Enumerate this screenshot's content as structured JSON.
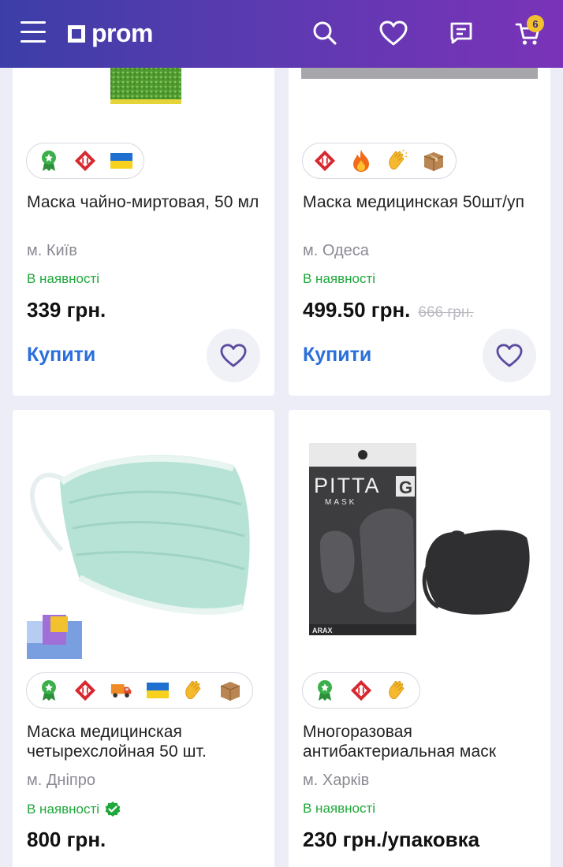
{
  "header": {
    "logo_text": "prom",
    "cart_count": "6",
    "icons": [
      "menu-icon",
      "search-icon",
      "heart-icon",
      "messages-icon",
      "cart-icon"
    ],
    "colors": {
      "gradient_start": "#3c3ea7",
      "gradient_end": "#7a33b8",
      "badge": "#f2c12e"
    }
  },
  "products": [
    {
      "title": "Маска чайно-миртовая, 50 мл",
      "city": "м. Київ",
      "stock": "В наявності",
      "price": "339 грн.",
      "old_price": "",
      "buy_label": "Купити",
      "badges": [
        "award-icon",
        "nova-poshta-icon",
        "ukraine-flag-icon"
      ]
    },
    {
      "title": "Маска медицинская 50шт/уп",
      "city": "м. Одеса",
      "stock": "В наявності",
      "price": "499.50 грн.",
      "old_price": "666 грн.",
      "buy_label": "Купити",
      "badges": [
        "nova-poshta-icon",
        "fire-icon",
        "clapping-hands-icon",
        "package-icon"
      ]
    },
    {
      "title": "Маска медицинская четырехслойная 50 шт.",
      "city": "м. Дніпро",
      "stock": "В наявності",
      "price": "800 грн.",
      "verified": true,
      "badges": [
        "award-icon",
        "nova-poshta-icon",
        "delivery-truck-icon",
        "ukraine-flag-icon",
        "clapping-hands-icon",
        "package-icon"
      ]
    },
    {
      "title": "Многоразовая антибактериальная маск",
      "city": "м. Харків",
      "stock": "В наявності",
      "price": "230 грн./упаковка",
      "badges": [
        "award-icon",
        "nova-poshta-icon",
        "clapping-hands-icon"
      ],
      "image_text": {
        "brand": "PITTA",
        "letter": "G",
        "sub": "MASK",
        "maker": "ARAX"
      }
    }
  ],
  "colors": {
    "in_stock": "#1ea83a",
    "buy": "#2a6fdb",
    "fav_heart": "#5b4aa0"
  }
}
